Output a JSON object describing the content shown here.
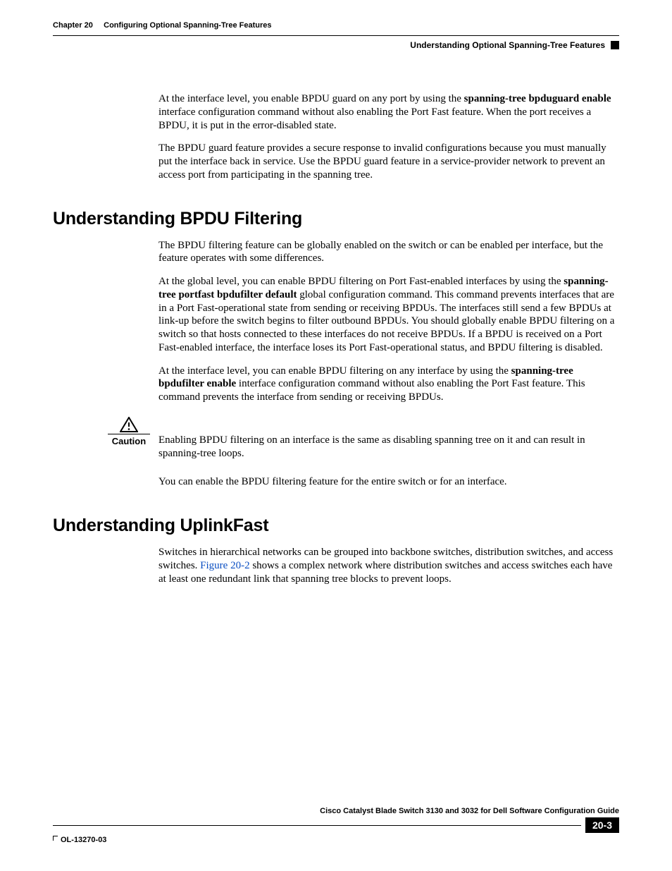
{
  "header": {
    "chapter_label": "Chapter 20",
    "chapter_title": "Configuring Optional Spanning-Tree Features",
    "section_title": "Understanding Optional Spanning-Tree Features"
  },
  "intro": {
    "p1a": "At the interface level, you enable BPDU guard on any port by using the ",
    "p1b": "spanning-tree bpduguard enable",
    "p1c": " interface configuration command without also enabling the Port Fast feature. When the port receives a BPDU, it is put in the error-disabled state.",
    "p2": "The BPDU guard feature provides a secure response to invalid configurations because you must manually put the interface back in service. Use the BPDU guard feature in a service-provider network to prevent an access port from participating in the spanning tree."
  },
  "bpdu_filtering": {
    "heading": "Understanding BPDU Filtering",
    "p1": "The BPDU filtering feature can be globally enabled on the switch or can be enabled per interface, but the feature operates with some differences.",
    "p2a": "At the global level, you can enable BPDU filtering on Port Fast-enabled interfaces by using the ",
    "p2b": "spanning-tree portfast bpdufilter default",
    "p2c": " global configuration command. This command prevents interfaces that are in a Port Fast-operational state from sending or receiving BPDUs. The interfaces still send a few BPDUs at link-up before the switch begins to filter outbound BPDUs. You should globally enable BPDU filtering on a switch so that hosts connected to these interfaces do not receive BPDUs. If a BPDU is received on a Port Fast-enabled interface, the interface loses its Port Fast-operational status, and BPDU filtering is disabled.",
    "p3a": "At the interface level, you can enable BPDU filtering on any interface by using the ",
    "p3b": "spanning-tree bpdufilter enable",
    "p3c": " interface configuration command without also enabling the Port Fast feature. This command prevents the interface from sending or receiving BPDUs.",
    "caution_label": "Caution",
    "caution_text": "Enabling BPDU filtering on an interface is the same as disabling spanning tree on it and can result in spanning-tree loops.",
    "p4": "You can enable the BPDU filtering feature for the entire switch or for an interface."
  },
  "uplinkfast": {
    "heading": "Understanding UplinkFast",
    "p1a": "Switches in hierarchical networks can be grouped into backbone switches, distribution switches, and access switches. ",
    "p1b": "Figure 20-2",
    "p1c": " shows a complex network where distribution switches and access switches each have at least one redundant link that spanning tree blocks to prevent loops."
  },
  "footer": {
    "book_title": "Cisco Catalyst Blade Switch 3130 and 3032 for Dell Software Configuration Guide",
    "doc_id": "OL-13270-03",
    "page_number": "20-3"
  }
}
